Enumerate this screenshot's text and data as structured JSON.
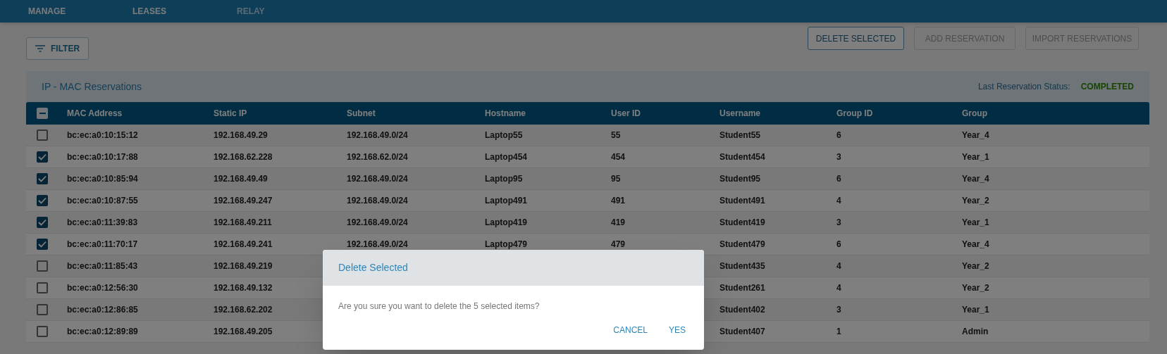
{
  "nav_tabs": [
    {
      "label": "MANAGE",
      "disabled": false
    },
    {
      "label": "LEASES",
      "disabled": false
    },
    {
      "label": "RELAY",
      "disabled": true
    }
  ],
  "filter_button": {
    "label": "FILTER"
  },
  "actions": [
    {
      "label": "DELETE SELECTED",
      "disabled": false
    },
    {
      "label": "ADD RESERVATION",
      "disabled": true
    },
    {
      "label": "IMPORT RESERVATIONS",
      "disabled": true
    }
  ],
  "panel": {
    "title": "IP - MAC Reservations",
    "status_label": "Last Reservation Status:",
    "status_value": "COMPLETED"
  },
  "table": {
    "select_all": {
      "indeterminate": true
    },
    "columns": [
      "MAC Address",
      "Static IP",
      "Subnet",
      "Hostname",
      "User ID",
      "Username",
      "Group ID",
      "Group"
    ],
    "rows": [
      {
        "checked": false,
        "mac": "bc:ec:a0:10:15:12",
        "static_ip": "192.168.49.29",
        "subnet": "192.168.49.0/24",
        "hostname": "Laptop55",
        "user_id": "55",
        "username": "Student55",
        "group_id": "6",
        "group": "Year_4"
      },
      {
        "checked": true,
        "mac": "bc:ec:a0:10:17:88",
        "static_ip": "192.168.62.228",
        "subnet": "192.168.62.0/24",
        "hostname": "Laptop454",
        "user_id": "454",
        "username": "Student454",
        "group_id": "3",
        "group": "Year_1"
      },
      {
        "checked": true,
        "mac": "bc:ec:a0:10:85:94",
        "static_ip": "192.168.49.49",
        "subnet": "192.168.49.0/24",
        "hostname": "Laptop95",
        "user_id": "95",
        "username": "Student95",
        "group_id": "6",
        "group": "Year_4"
      },
      {
        "checked": true,
        "mac": "bc:ec:a0:10:87:55",
        "static_ip": "192.168.49.247",
        "subnet": "192.168.49.0/24",
        "hostname": "Laptop491",
        "user_id": "491",
        "username": "Student491",
        "group_id": "4",
        "group": "Year_2"
      },
      {
        "checked": true,
        "mac": "bc:ec:a0:11:39:83",
        "static_ip": "192.168.49.211",
        "subnet": "192.168.49.0/24",
        "hostname": "Laptop419",
        "user_id": "419",
        "username": "Student419",
        "group_id": "3",
        "group": "Year_1"
      },
      {
        "checked": true,
        "mac": "bc:ec:a0:11:70:17",
        "static_ip": "192.168.49.241",
        "subnet": "192.168.49.0/24",
        "hostname": "Laptop479",
        "user_id": "479",
        "username": "Student479",
        "group_id": "6",
        "group": "Year_4"
      },
      {
        "checked": false,
        "mac": "bc:ec:a0:11:85:43",
        "static_ip": "192.168.49.219",
        "username": "Student435",
        "group_id": "4",
        "group": "Year_2"
      },
      {
        "checked": false,
        "mac": "bc:ec:a0:12:56:30",
        "static_ip": "192.168.49.132",
        "username": "Student261",
        "group_id": "4",
        "group": "Year_2"
      },
      {
        "checked": false,
        "mac": "bc:ec:a0:12:86:85",
        "static_ip": "192.168.62.202",
        "username": "Student402",
        "group_id": "3",
        "group": "Year_1"
      },
      {
        "checked": false,
        "mac": "bc:ec:a0:12:89:89",
        "static_ip": "192.168.49.205",
        "username": "Student407",
        "group_id": "1",
        "group": "Admin"
      }
    ]
  },
  "dialog": {
    "title": "Delete Selected",
    "message": "Are you sure you want to delete the 5 selected items?",
    "buttons": [
      "CANCEL",
      "YES"
    ]
  }
}
